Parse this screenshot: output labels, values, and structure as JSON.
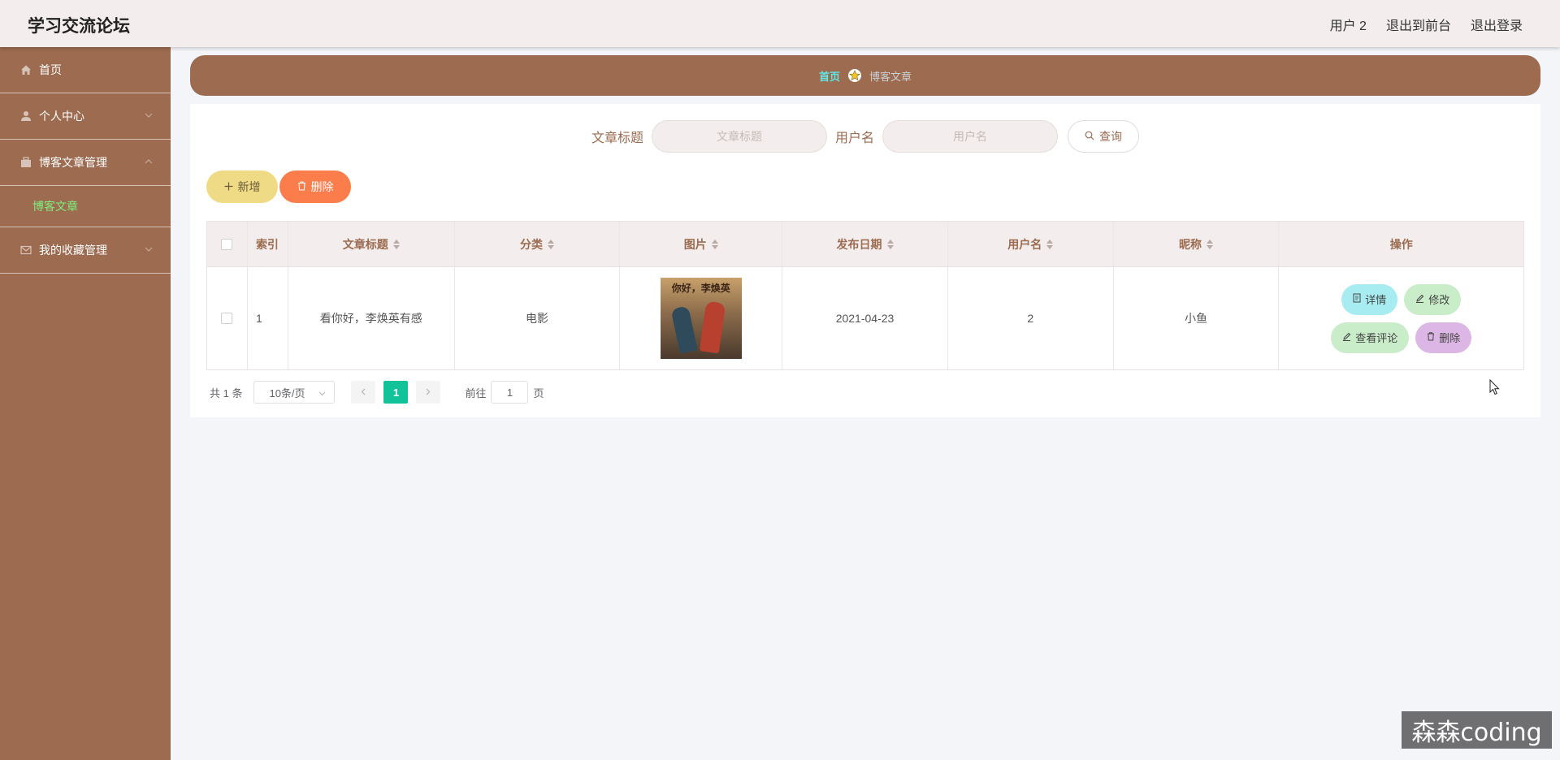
{
  "app": {
    "title": "学习交流论坛"
  },
  "header": {
    "user": "用户 2",
    "to_front": "退出到前台",
    "logout": "退出登录"
  },
  "sidebar": {
    "items": [
      {
        "label": "首页",
        "icon": "home-icon"
      },
      {
        "label": "个人中心",
        "icon": "user-icon"
      },
      {
        "label": "博客文章管理",
        "icon": "folder-icon"
      },
      {
        "label": "我的收藏管理",
        "icon": "mail-icon"
      }
    ],
    "submenu": {
      "label": "博客文章"
    }
  },
  "breadcrumb": {
    "home": "首页",
    "current": "博客文章"
  },
  "search": {
    "title_label": "文章标题",
    "title_placeholder": "文章标题",
    "user_label": "用户名",
    "user_placeholder": "用户名",
    "query_label": "查询"
  },
  "actions": {
    "add_label": "新增",
    "delete_label": "删除"
  },
  "table": {
    "columns": [
      "索引",
      "文章标题",
      "分类",
      "图片",
      "发布日期",
      "用户名",
      "昵称",
      "操作"
    ],
    "rows": [
      {
        "index": "1",
        "title": "看你好，李焕英有感",
        "category": "电影",
        "image_caption": "你好，李焕英",
        "date": "2021-04-23",
        "username": "2",
        "nickname": "小鱼",
        "ops": {
          "detail": "详情",
          "edit": "修改",
          "comments": "查看评论",
          "delete": "删除"
        }
      }
    ]
  },
  "pagination": {
    "total_text": "共 1 条",
    "page_size": "10条/页",
    "current_page": "1",
    "goto_prefix": "前往",
    "goto_value": "1",
    "goto_suffix": "页"
  },
  "watermark": "森森coding",
  "colors": {
    "primary": "#9c6b50",
    "header_bg": "#f3eeed",
    "active_page": "#12c39a",
    "submenu_active": "#7cf07c"
  }
}
